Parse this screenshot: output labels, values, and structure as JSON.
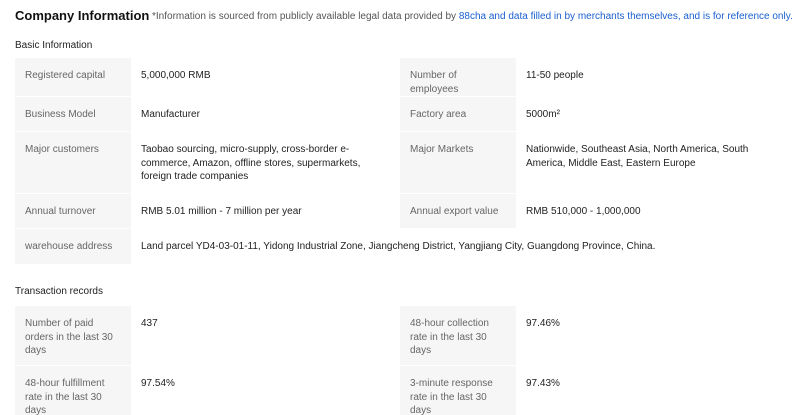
{
  "header": {
    "title": "Company Information",
    "notice_prefix": "*Information is sourced from publicly available legal data provided by ",
    "notice_link": "88cha",
    "notice_suffix": " and data filled in by merchants themselves, and is for reference only."
  },
  "basic": {
    "title": "Basic Information",
    "rows": [
      [
        {
          "label": "Registered capital",
          "value": "5,000,000 RMB"
        },
        {
          "label": "Number of employees",
          "value": "11-50 people"
        }
      ],
      [
        {
          "label": "Business Model",
          "value": "Manufacturer"
        },
        {
          "label": "Factory area",
          "value": "5000m²"
        }
      ],
      [
        {
          "label": "Major customers",
          "value": "Taobao sourcing, micro-supply, cross-border e-commerce, Amazon, offline stores, supermarkets, foreign trade companies"
        },
        {
          "label": "Major Markets",
          "value": "Nationwide, Southeast Asia, North America, South America, Middle East, Eastern Europe"
        }
      ],
      [
        {
          "label": "Annual turnover",
          "value": "RMB 5.01 million - 7 million per year"
        },
        {
          "label": "Annual export value",
          "value": "RMB 510,000 - 1,000,000"
        }
      ]
    ],
    "warehouse": {
      "label": "warehouse address",
      "value": "Land parcel YD4-03-01-11, Yidong Industrial Zone, Jiangcheng District, Yangjiang City, Guangdong Province, China."
    }
  },
  "transactions": {
    "title": "Transaction records",
    "rows": [
      [
        {
          "label": "Number of paid orders in the last 30 days",
          "value": "437"
        },
        {
          "label": "48-hour collection rate in the last 30 days",
          "value": "97.46%"
        }
      ],
      [
        {
          "label": "48-hour fulfillment rate in the last 30 days",
          "value": "97.54%"
        },
        {
          "label": "3-minute response rate in the last 30 days",
          "value": "97.43%"
        }
      ]
    ]
  }
}
